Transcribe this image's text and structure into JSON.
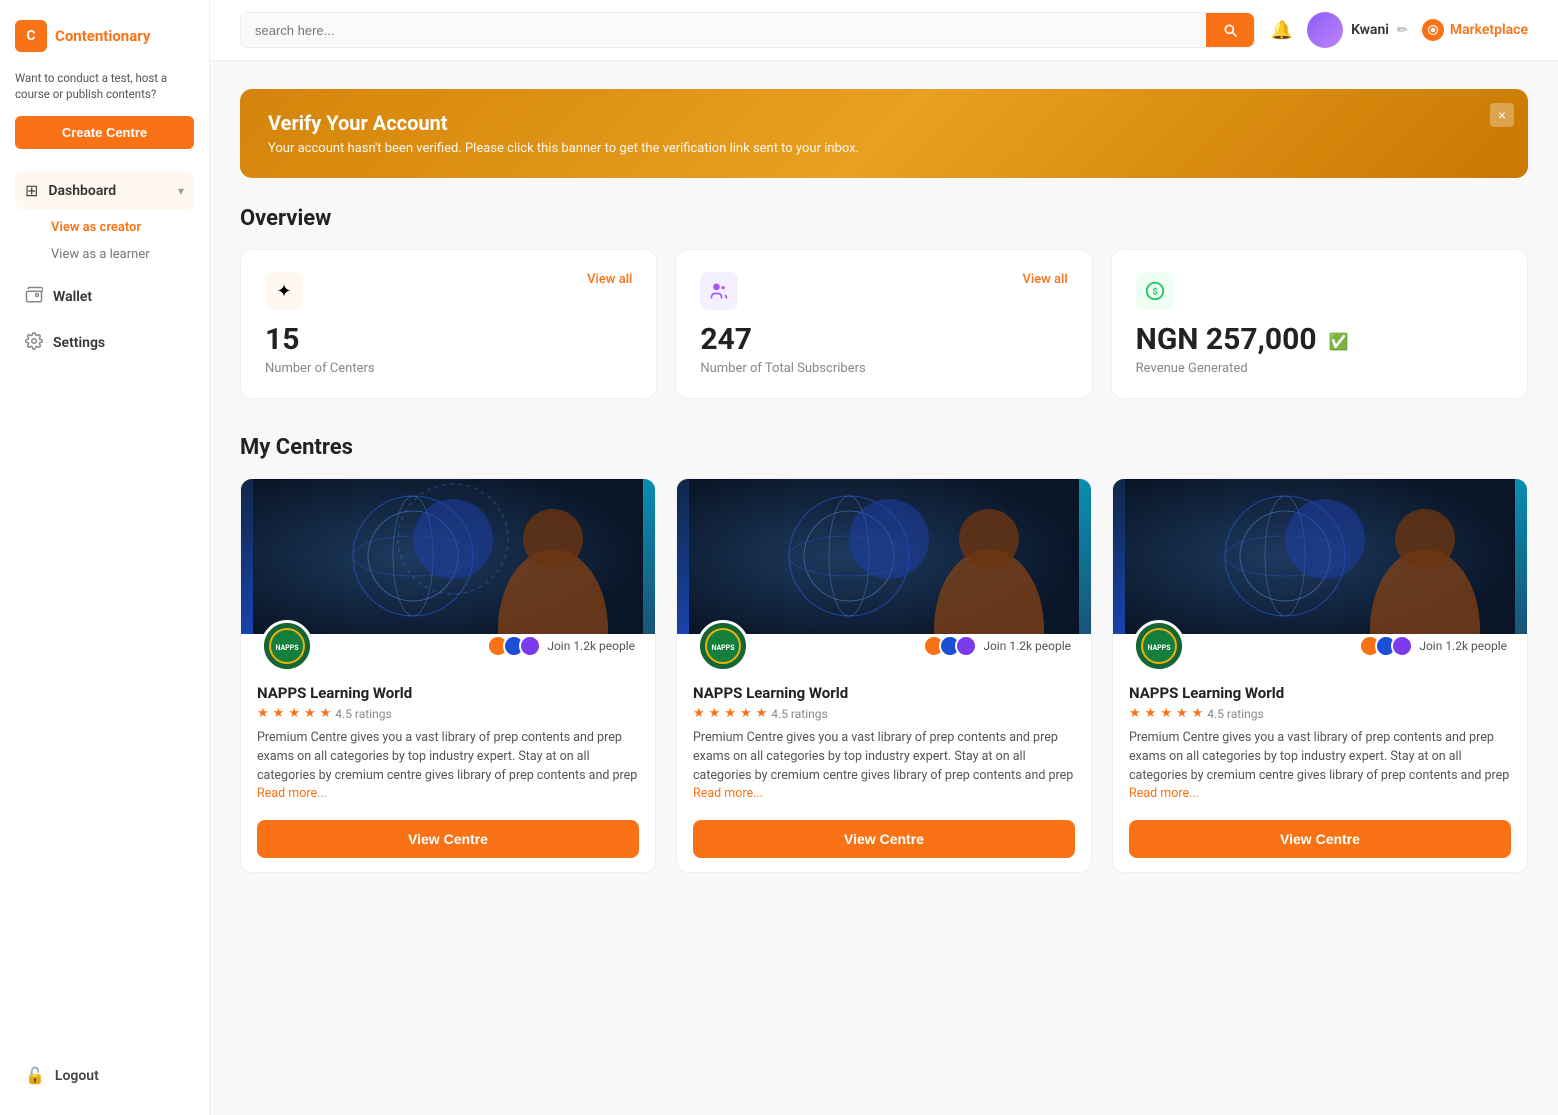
{
  "app": {
    "name": "Contentionary",
    "logo_letter": "C"
  },
  "sidebar": {
    "tagline": "Want to conduct a test, host a course or publish contents?",
    "create_centre_label": "Create Centre",
    "nav_items": [
      {
        "id": "dashboard",
        "label": "Dashboard",
        "icon": "⊞",
        "active": true,
        "has_expand": true
      },
      {
        "id": "wallet",
        "label": "Wallet",
        "icon": "👝",
        "active": false
      },
      {
        "id": "settings",
        "label": "Settings",
        "icon": "⚙",
        "active": false
      }
    ],
    "sub_nav": [
      {
        "id": "view-creator",
        "label": "View as creator",
        "active": true
      },
      {
        "id": "view-learner",
        "label": "View as a learner",
        "active": false
      }
    ],
    "logout_label": "Logout",
    "logout_icon": "🔓"
  },
  "topbar": {
    "search_placeholder": "search here...",
    "search_icon": "search",
    "user_name": "Kwani",
    "marketplace_label": "Marketplace"
  },
  "banner": {
    "title": "Verify Your Account",
    "message": "Your account hasn't been verified. Please click this banner to get the verification link sent to your inbox.",
    "close_label": "×"
  },
  "overview": {
    "title": "Overview",
    "cards": [
      {
        "id": "centres",
        "icon": "✦",
        "icon_type": "orange",
        "view_all_label": "View all",
        "number": "15",
        "label": "Number of Centers"
      },
      {
        "id": "subscribers",
        "icon": "👤",
        "icon_type": "purple",
        "view_all_label": "View all",
        "number": "247",
        "label": "Number of Total Subscribers"
      },
      {
        "id": "revenue",
        "icon": "💰",
        "icon_type": "green",
        "number": "NGN 257,000",
        "label": "Revenue Generated"
      }
    ]
  },
  "my_centres": {
    "title": "My Centres",
    "cards": [
      {
        "id": "centre-1",
        "name": "NAPPS Learning World",
        "rating": "4.5",
        "rating_label": "4.5 ratings",
        "description": "Premium Centre gives you a vast library of prep contents and prep exams on all categories by top industry expert. Stay at on all categories by cremium centre gives library of prep contents and prep",
        "read_more_label": "Read more...",
        "join_label": "Join 1.2k people",
        "view_btn_label": "View Centre"
      },
      {
        "id": "centre-2",
        "name": "NAPPS Learning World",
        "rating": "4.5",
        "rating_label": "4.5 ratings",
        "description": "Premium Centre gives you a vast library of prep contents and prep exams on all categories by top industry expert. Stay at on all categories by cremium centre gives library of prep contents and prep",
        "read_more_label": "Read more...",
        "join_label": "Join 1.2k people",
        "view_btn_label": "View Centre"
      },
      {
        "id": "centre-3",
        "name": "NAPPS Learning World",
        "rating": "4.5",
        "rating_label": "4.5 ratings",
        "description": "Premium Centre gives you a vast library of prep contents and prep exams on all categories by top industry expert. Stay at on all categories by cremium centre gives library of prep contents and prep",
        "read_more_label": "Read more...",
        "join_label": "Join 1.2k people",
        "view_btn_label": "View Centre"
      }
    ]
  },
  "colors": {
    "primary": "#f97316",
    "banner_bg": "#d4840a",
    "success": "#22c55e"
  }
}
